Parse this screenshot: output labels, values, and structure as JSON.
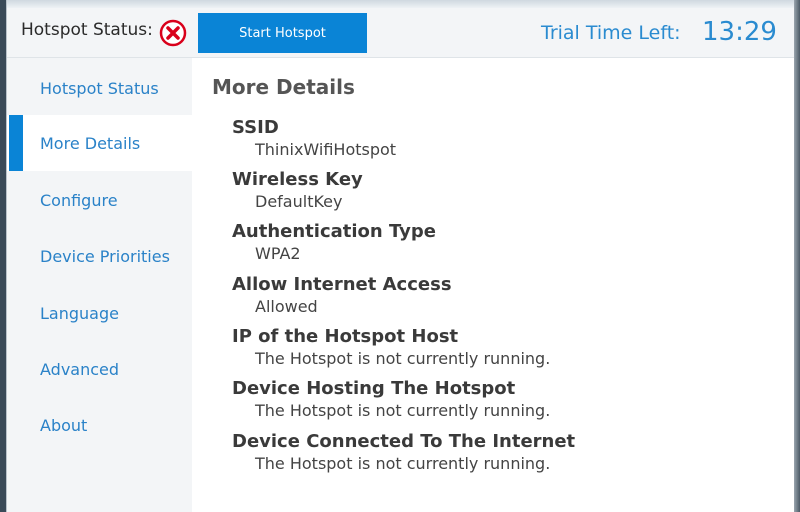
{
  "header": {
    "status_label": "Hotspot Status:",
    "status_icon": "error-x-icon",
    "start_button": "Start Hotspot",
    "trial_label": "Trial Time Left:",
    "trial_time": "13:29"
  },
  "sidebar": {
    "items": [
      {
        "label": "Hotspot Status",
        "active": false
      },
      {
        "label": "More Details",
        "active": true
      },
      {
        "label": "Configure",
        "active": false
      },
      {
        "label": "Device Priorities",
        "active": false
      },
      {
        "label": "Language",
        "active": false
      },
      {
        "label": "Advanced",
        "active": false
      },
      {
        "label": "About",
        "active": false
      }
    ]
  },
  "main": {
    "title": "More Details",
    "fields": [
      {
        "name": "SSID",
        "value": "ThinixWifiHotspot"
      },
      {
        "name": "Wireless Key",
        "value": "DefaultKey"
      },
      {
        "name": "Authentication Type",
        "value": "WPA2"
      },
      {
        "name": "Allow Internet Access",
        "value": "Allowed"
      },
      {
        "name": "IP of the Hotspot Host",
        "value": "The Hotspot is not currently running."
      },
      {
        "name": "Device Hosting The Hotspot",
        "value": "The Hotspot is not currently running."
      },
      {
        "name": "Device Connected To The Internet",
        "value": "The Hotspot is not currently running."
      }
    ]
  },
  "colors": {
    "accent": "#0a84d6",
    "link": "#2a82c8",
    "error": "#d9001b"
  }
}
